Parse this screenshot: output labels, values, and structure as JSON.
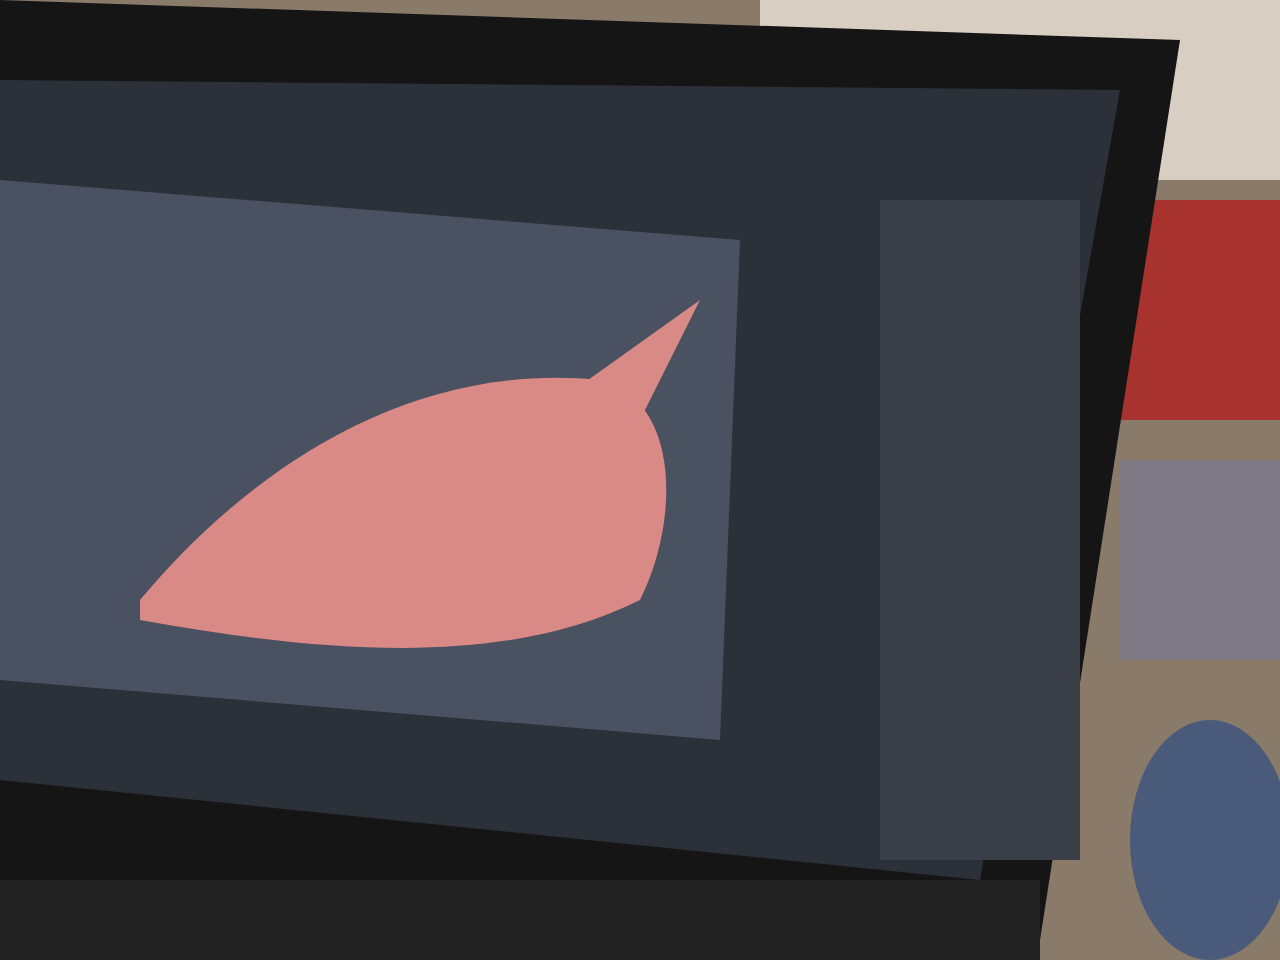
{
  "photo": {
    "kind": "laptop"
  }
}
